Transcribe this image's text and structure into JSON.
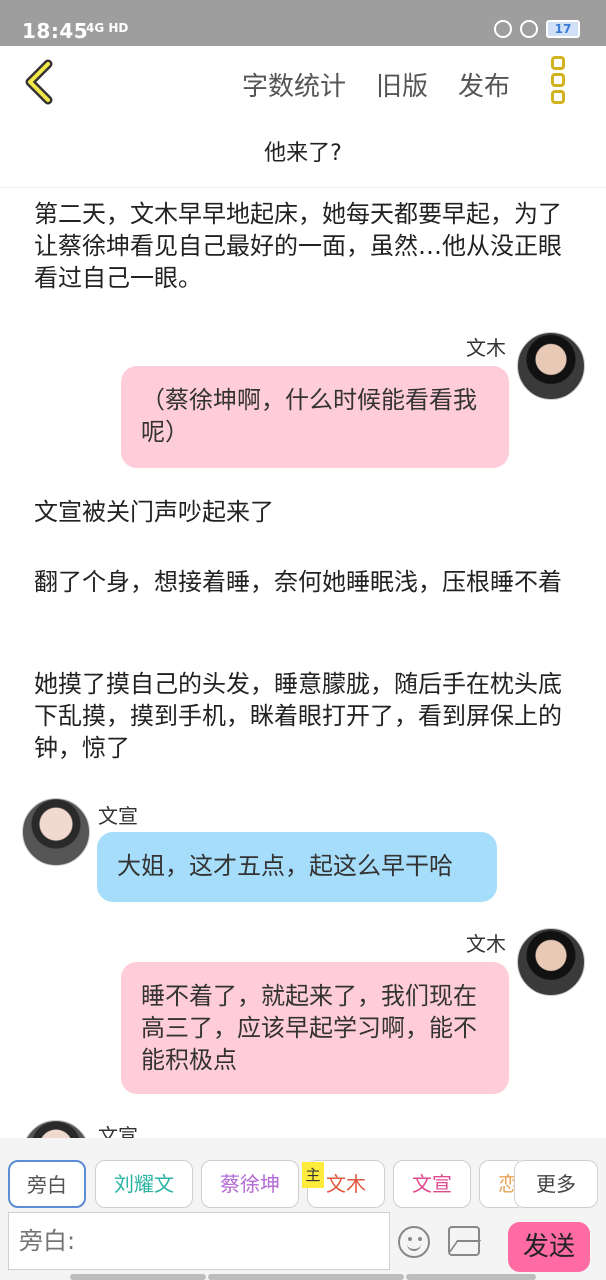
{
  "status_bar": {
    "time": "18:45",
    "network": "4G HD",
    "battery": "17"
  },
  "header": {
    "actions": [
      "字数统计",
      "旧版",
      "发布"
    ]
  },
  "title": "他来了?",
  "story": {
    "paragraph_1": "第二天，文木早早地起床，她每天都要早起，为了让蔡徐坤看见自己最好的一面，虽然…他从没正眼看过自己一眼。",
    "message_1": {
      "speaker": "文木",
      "text": "（蔡徐坤啊，什么时候能看看我呢）"
    },
    "paragraph_2": "文宣被关门声吵起来了",
    "paragraph_3": "翻了个身，想接着睡，奈何她睡眠浅，压根睡不着",
    "paragraph_4": "她摸了摸自己的头发，睡意朦胧，随后手在枕头底下乱摸，摸到手机，眯着眼打开了，看到屏保上的钟，惊了",
    "message_2": {
      "speaker": "文宣",
      "text": "大姐，这才五点，起这么早干哈"
    },
    "message_3": {
      "speaker": "文木",
      "text": "睡不着了，就起来了，我们现在高三了，应该早起学习啊，能不能积极点"
    },
    "message_4": {
      "speaker": "文宣"
    }
  },
  "roles": {
    "items": [
      "旁白",
      "刘耀文",
      "蔡徐坤",
      "文木",
      "文宣",
      "恋"
    ],
    "colors": [
      "#555555",
      "#2bb3a3",
      "#b36ad6",
      "#e2583e",
      "#e04b8f",
      "#e8a35a"
    ],
    "owner_badge": "主",
    "more_label": "更多"
  },
  "input": {
    "placeholder": "旁白:",
    "send_label": "发送"
  }
}
